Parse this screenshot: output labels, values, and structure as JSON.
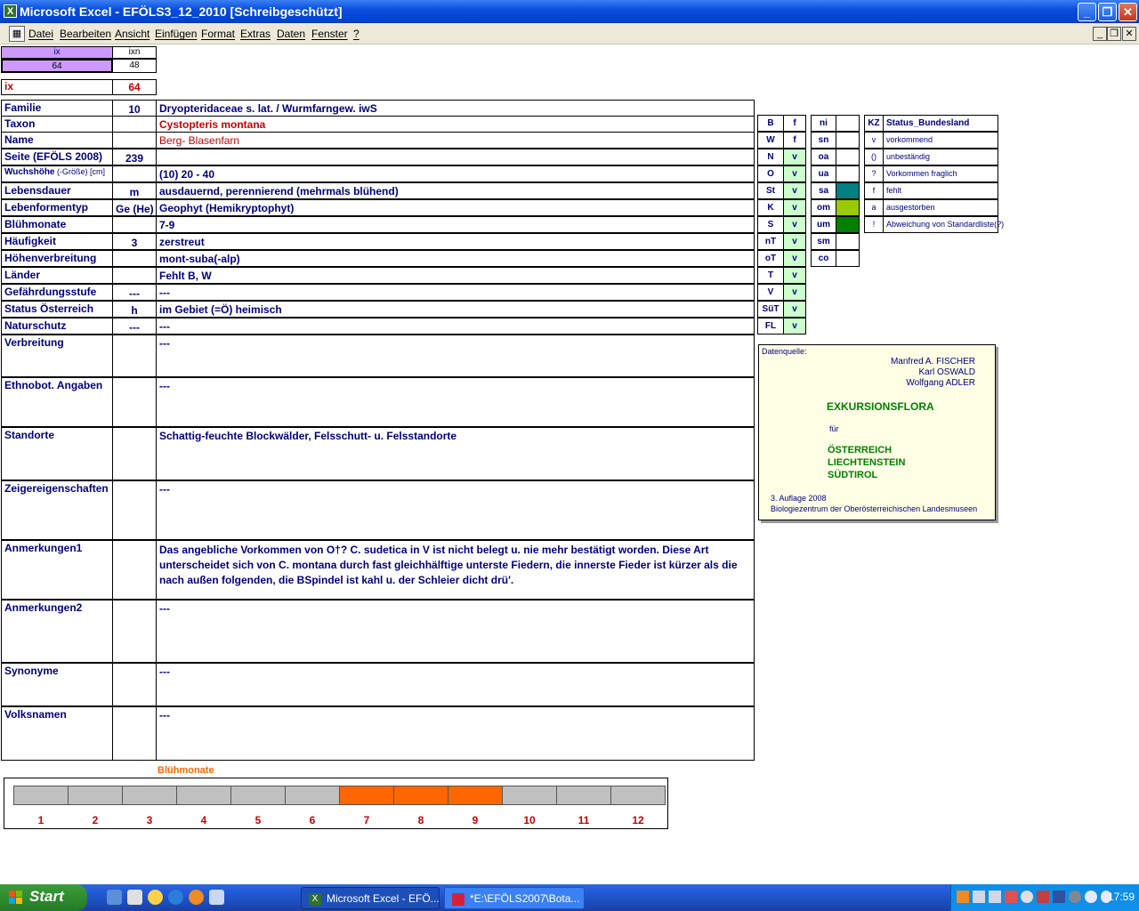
{
  "window": {
    "title": "Microsoft Excel - EFÖLS3_12_2010  [Schreibgeschützt]",
    "app_icon": "excel-icon"
  },
  "menu": [
    "Datei",
    "Bearbeiten",
    "Ansicht",
    "Einfügen",
    "Format",
    "Extras",
    "Daten",
    "Fenster",
    "?"
  ],
  "index": {
    "ix_h": "ix",
    "ixn_h": "ixn",
    "ix_v": "64",
    "ixn_v": "48",
    "ix_label": "ix",
    "ix_value": "64"
  },
  "fields": [
    {
      "label": "Familie",
      "mid": "10",
      "value": "Dryopteridaceae s. lat.  /  Wurmfarngew. iwS"
    },
    {
      "label": "Taxon",
      "mid": "",
      "value": "Cystopteris montana"
    },
    {
      "label": "Name",
      "mid": "",
      "value": "Berg- Blasenfarn"
    },
    {
      "label": "Seite (EFÖLS 2008)",
      "mid": "239",
      "value": ""
    },
    {
      "label": "Wuchshöhe",
      "label_suffix": " (-Größe) [cm]",
      "mid": "",
      "value": "(10) 20 - 40"
    },
    {
      "label": "Lebensdauer",
      "mid": "m",
      "value": "ausdauernd, perennierend (mehrmals blühend)"
    },
    {
      "label": "Lebenformentyp",
      "mid": "Ge (He)",
      "value": "Geophyt (Hemikryptophyt)"
    },
    {
      "label": "Blühmonate",
      "mid": "",
      "value": "7-9"
    },
    {
      "label": "Häufigkeit",
      "mid": "3",
      "value": "zerstreut"
    },
    {
      "label": "Höhenverbreitung",
      "mid": "",
      "value": "mont-suba(-alp)"
    },
    {
      "label": "Länder",
      "mid": "",
      "value": "Fehlt B, W"
    },
    {
      "label": "Gefährdungsstufe",
      "mid": "---",
      "value": "  ---"
    },
    {
      "label": "Status Österreich",
      "mid": "h",
      "value": "im Gebiet (=Ö) heimisch"
    },
    {
      "label": "Naturschutz",
      "mid": "---",
      "value": "---"
    },
    {
      "label": "Verbreitung",
      "mid": "",
      "value": "---"
    },
    {
      "label": "Ethnobot. Angaben",
      "mid": "",
      "value": "---"
    },
    {
      "label": "Standorte",
      "mid": "",
      "value": "Schattig-feuchte Blockwälder, Felsschutt- u. Felsstandorte"
    },
    {
      "label": "Zeigereigenschaften",
      "mid": "",
      "value": "---"
    },
    {
      "label": "Anmerkungen1",
      "mid": "",
      "value": "Das angebliche Vorkommen von O†? C. sudetica in V ist nicht belegt u. nie mehr bestätigt worden. Diese Art unterscheidet sich von C. montana durch fast gleichhälftige unterste Fiedern, die innerste Fieder ist kürzer als die nach außen folgenden, die BSpindel ist kahl u. der Schleier dicht drü'."
    },
    {
      "label": "Anmerkungen2",
      "mid": "",
      "value": "---"
    },
    {
      "label": "Synonyme",
      "mid": "",
      "value": "---"
    },
    {
      "label": "Volksnamen",
      "mid": "",
      "value": "---"
    }
  ],
  "states": {
    "h1": "B",
    "h2": "f",
    "rows": [
      [
        "W",
        "f"
      ],
      [
        "N",
        "v"
      ],
      [
        "O",
        "v"
      ],
      [
        "St",
        "v"
      ],
      [
        "K",
        "v"
      ],
      [
        "S",
        "v"
      ],
      [
        "nT",
        "v"
      ],
      [
        "oT",
        "v"
      ],
      [
        "T",
        "v"
      ],
      [
        "V",
        "v"
      ],
      [
        "SüT",
        "v"
      ],
      [
        "FL",
        "v"
      ]
    ]
  },
  "zones": {
    "h": "ni",
    "rows": [
      "sn",
      "oa",
      "ua",
      "sa",
      "om",
      "um",
      "sm",
      "co"
    ],
    "swatch_colors": [
      "#008080",
      "#99cc00",
      "#008000"
    ]
  },
  "legend": {
    "h1": "KZ",
    "h2": "Status_Bundesland",
    "rows": [
      [
        "v",
        "vorkommend"
      ],
      [
        "()",
        "unbeständig"
      ],
      [
        "?",
        "Vorkommen fraglich"
      ],
      [
        "f",
        "fehlt"
      ],
      [
        "a",
        "ausgestorben"
      ],
      [
        "!",
        "Abweichung von Standardliste(?)"
      ]
    ]
  },
  "source": {
    "label": "Datenquelle:",
    "authors": [
      "Manfred A. FISCHER",
      "Karl OSWALD",
      "Wolfgang ADLER"
    ],
    "title": "EXKURSIONSFLORA",
    "fuer": "für",
    "countries": [
      "ÖSTERREICH",
      "LIECHTENSTEIN",
      "SÜDTIROL"
    ],
    "edition": "3. Auflage 2008",
    "publisher": "Biologiezentrum der Oberösterreichischen Landesmuseen"
  },
  "chart_data": {
    "type": "bar",
    "title": "Blühmonate",
    "categories": [
      "1",
      "2",
      "3",
      "4",
      "5",
      "6",
      "7",
      "8",
      "9",
      "10",
      "11",
      "12"
    ],
    "values": [
      0,
      0,
      0,
      0,
      0,
      0,
      1,
      1,
      1,
      0,
      0,
      0
    ],
    "colors": {
      "active": "#ff6600",
      "inactive": "#c0c0c0"
    }
  },
  "taskbar": {
    "start": "Start",
    "tasks": [
      "Microsoft Excel - EFÖ...",
      "*E:\\EFÖLS2007\\Bota..."
    ],
    "clock": "17:59"
  }
}
